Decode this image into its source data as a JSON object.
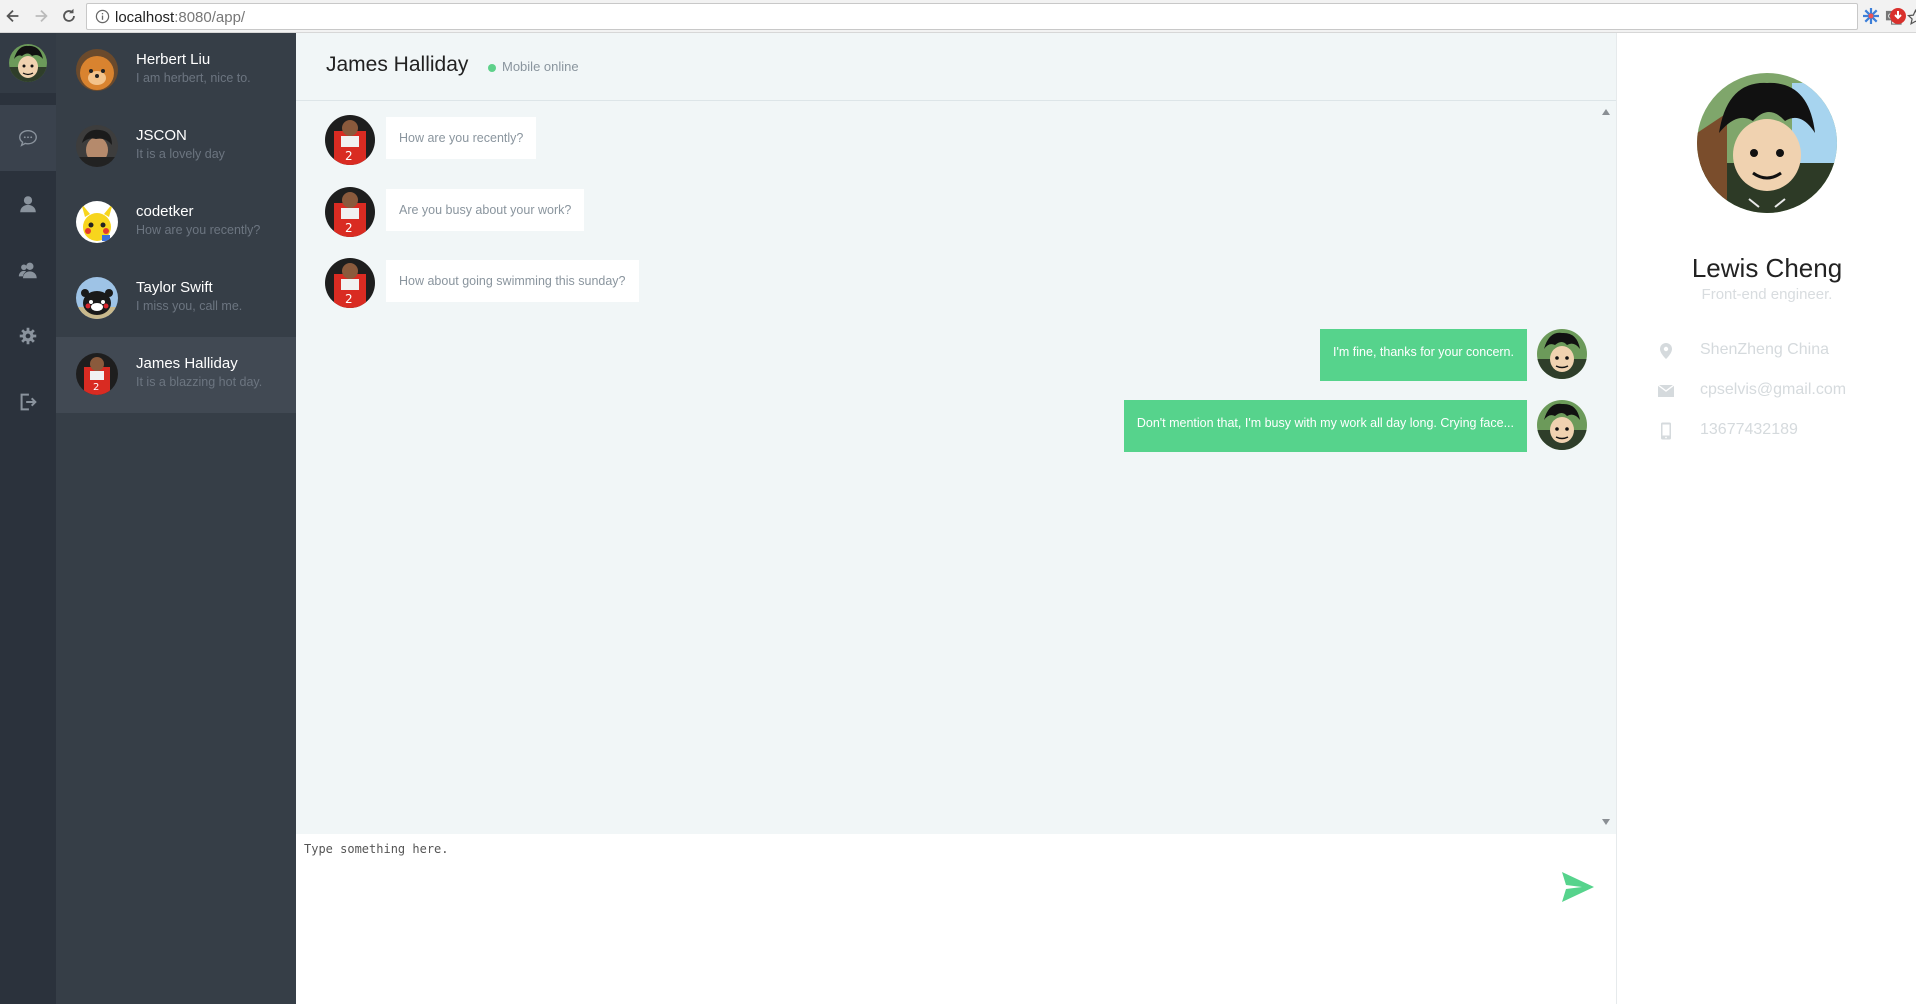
{
  "browser": {
    "url_host": "localhost",
    "url_rest": ":8080/app/"
  },
  "rail": {
    "items": [
      {
        "name": "messages",
        "icon": "chat-bubble-icon"
      },
      {
        "name": "contacts",
        "icon": "user-icon"
      },
      {
        "name": "groups",
        "icon": "users-icon"
      },
      {
        "name": "settings",
        "icon": "gear-icon"
      },
      {
        "name": "logout",
        "icon": "sign-out-icon"
      }
    ]
  },
  "contacts": [
    {
      "name": "Herbert Liu",
      "preview": "I am herbert, nice to."
    },
    {
      "name": "JSCON",
      "preview": "It is a lovely day"
    },
    {
      "name": "codetker",
      "preview": "How are you recently?"
    },
    {
      "name": "Taylor Swift",
      "preview": "I miss you, call me."
    },
    {
      "name": "James Halliday",
      "preview": "It is a blazzing hot day."
    }
  ],
  "chat": {
    "title": "James Halliday",
    "status": "Mobile online",
    "messages": [
      {
        "from": "them",
        "text": "How are you recently?"
      },
      {
        "from": "them",
        "text": "Are you busy about your work?"
      },
      {
        "from": "them",
        "text": "How about going swimming this sunday?"
      },
      {
        "from": "me",
        "text": "I'm fine, thanks for your concern."
      },
      {
        "from": "me",
        "text": "Don't mention that, I'm busy with my work all day long. Crying face..."
      }
    ],
    "composer_placeholder": "Type something here."
  },
  "profile": {
    "name": "Lewis Cheng",
    "title": "Front-end engineer.",
    "location": "ShenZheng China",
    "email": "cpselvis@gmail.com",
    "phone": "13677432189"
  },
  "colors": {
    "rail": "#2b323c",
    "sidebar": "#363e47",
    "chat_bg": "#f1f6f7",
    "accent_green": "#56d38c"
  }
}
